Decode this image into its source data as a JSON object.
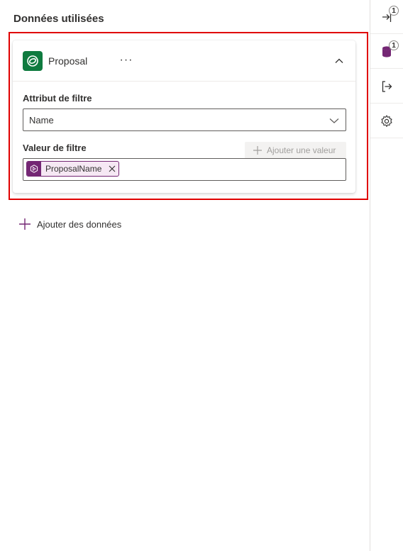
{
  "panel": {
    "title": "Données utilisées"
  },
  "data_source_card": {
    "name": "Proposal",
    "more_label": "···",
    "icon": "dataverse-icon",
    "icon_color": "#0f7b3f",
    "filter_attribute": {
      "label": "Attribut de filtre",
      "value": "Name"
    },
    "filter_value": {
      "label": "Valeur de filtre",
      "add_value_label": "Ajouter une valeur",
      "tags": [
        {
          "label": "ProposalName",
          "icon": "dynamic-value-icon",
          "color": "#742774"
        }
      ]
    }
  },
  "add_data": {
    "label": "Ajouter des données",
    "icon": "plus-icon",
    "icon_color": "#742774"
  },
  "rail": {
    "items": [
      {
        "name": "input-icon",
        "badge": "1"
      },
      {
        "name": "data-icon",
        "badge": "1",
        "color": "#742774"
      },
      {
        "name": "output-icon"
      },
      {
        "name": "settings-icon"
      }
    ]
  },
  "colors": {
    "highlight": "#e00000",
    "accent": "#742774"
  }
}
